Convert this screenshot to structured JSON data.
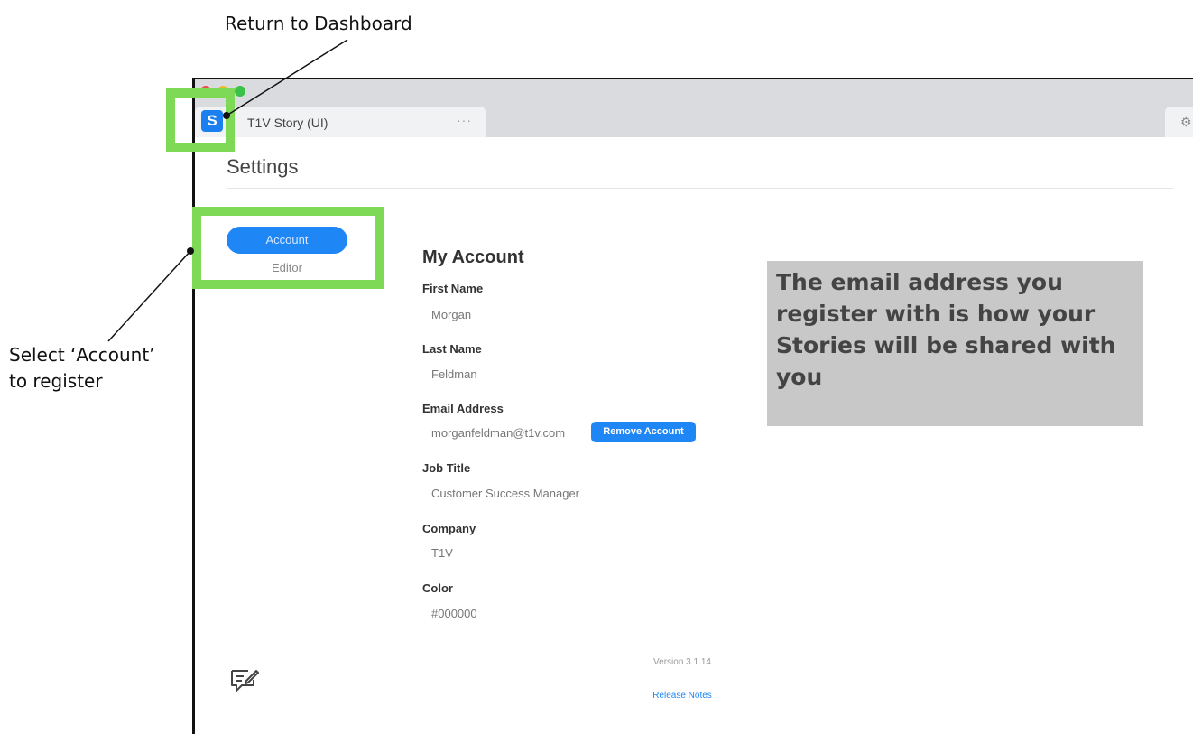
{
  "callouts": {
    "return_dashboard": "Return to Dashboard",
    "select_account_line1": "Select ‘Account’",
    "select_account_line2": "to register"
  },
  "app": {
    "logo_letter": "S",
    "tab_title": "T1V Story (UI)",
    "tab_more": "···"
  },
  "settings": {
    "title": "Settings",
    "nav": {
      "account": "Account",
      "editor": "Editor"
    }
  },
  "account": {
    "heading": "My Account",
    "fields": [
      {
        "label": "First Name",
        "value": "Morgan"
      },
      {
        "label": "Last Name",
        "value": "Feldman"
      },
      {
        "label": "Email Address",
        "value": "morganfeldman@t1v.com"
      },
      {
        "label": "Job Title",
        "value": "Customer Success Manager"
      },
      {
        "label": "Company",
        "value": "T1V"
      },
      {
        "label": "Color",
        "value": "#000000"
      }
    ],
    "remove_button": "Remove Account"
  },
  "footer": {
    "version": "Version 3.1.14",
    "release_notes": "Release Notes"
  },
  "info_box": {
    "text": "The email address you register with is how your Stories will be shared with you"
  },
  "colors": {
    "accent_blue": "#1f86f5",
    "highlight_green": "#7ed957",
    "info_gray": "#c8c8c8"
  },
  "icons": {
    "feedback": "feedback-icon",
    "gear": "gear-icon"
  }
}
